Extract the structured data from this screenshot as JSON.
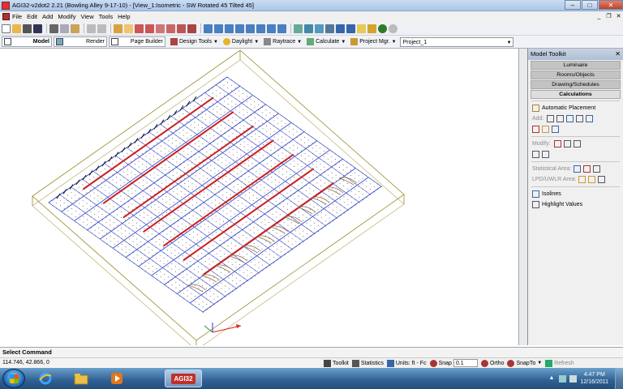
{
  "window": {
    "title": "AGI32-v2dot2 2.21 (Bowling Alley 9-17-10) - [View_1:Isometric - SW Rotated 45 Tilted 45]"
  },
  "menubar": {
    "items": [
      "File",
      "Edit",
      "Add",
      "Modify",
      "View",
      "Tools",
      "Help"
    ]
  },
  "toolbar2": {
    "modes": [
      "Model",
      "Render",
      "Page Builder"
    ],
    "menus": [
      "Design Tools",
      "Daylight",
      "Raytrace",
      "Calculate",
      "Project Mgr."
    ],
    "project": "Project_1"
  },
  "panel": {
    "title": "Model Toolkit",
    "tabs": [
      "Luminaire",
      "Rooms/Objects",
      "Drawing/Schedules",
      "Calculations"
    ],
    "active_tab": "Calculations",
    "automatic_placement": "Automatic Placement",
    "add_label": "Add:",
    "modify_label": "Modify:",
    "stat_area_label": "Statistical Area:",
    "lpd_label": "LPD/UWLR Area:",
    "isolines": "Isolines",
    "highlight_values": "Highlight Values"
  },
  "command": {
    "prompt": "Select Command",
    "coords": "114.746,  42.866,  0"
  },
  "statusbar": {
    "toolkit": "Toolkit",
    "statistics": "Statistics",
    "units": "Units: ft - Fc",
    "snap": "Snap",
    "snap_value": "0.1",
    "ortho": "Ortho",
    "snapto": "SnapTo",
    "refresh": "Refresh"
  },
  "taskbar": {
    "active_app": "AGI32",
    "time": "4:47 PM",
    "date": "12/16/2011"
  },
  "colors": {
    "luminaire_row": "#cc1f1f",
    "grid_blue": "#3c4fd0",
    "room_outline": "#9b8a2a",
    "lane_detail": "#8a6a4a"
  }
}
